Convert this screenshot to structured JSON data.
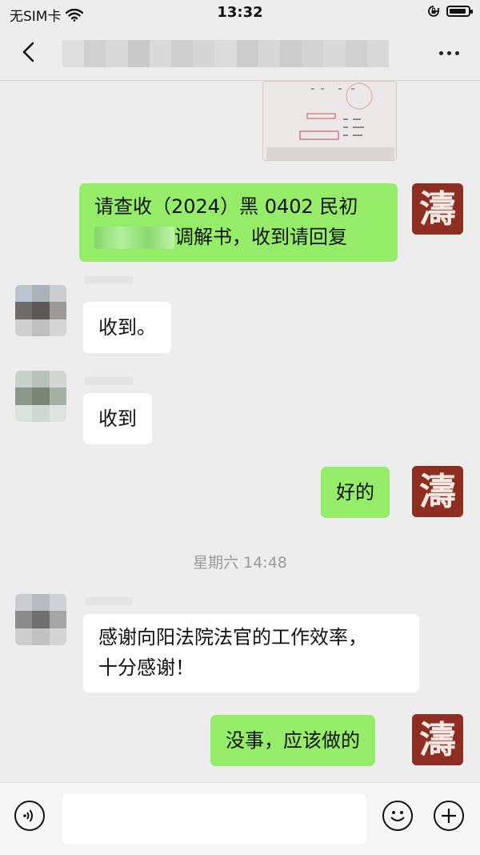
{
  "status_bar": {
    "carrier": "无SIM卡",
    "time": "13:32",
    "battery_level": 0.9
  },
  "nav": {
    "back_icon": "chevron-left-icon",
    "more_icon": "more-dots-icon"
  },
  "messages": [
    {
      "side": "right",
      "type": "image"
    },
    {
      "side": "right",
      "type": "text",
      "line1": "请查收（2024）黑 0402 民初",
      "line2_suffix": "调解书，收到请回复"
    },
    {
      "side": "left",
      "type": "text",
      "text": "收到。"
    },
    {
      "side": "left",
      "type": "text",
      "text": "收到"
    },
    {
      "side": "right",
      "type": "text",
      "text": "好的"
    },
    {
      "type": "time",
      "text": "星期六 14:48"
    },
    {
      "side": "left",
      "type": "text",
      "line1": "感谢向阳法院法官的工作效率，",
      "line2": "十分感谢！"
    },
    {
      "side": "right",
      "type": "text",
      "text": "没事，应该做的"
    }
  ],
  "my_avatar_glyph": "濤",
  "composer": {
    "voice_icon": "voice-icon",
    "emoji_icon": "emoji-icon",
    "plus_icon": "plus-icon"
  },
  "colors": {
    "background": "#ededed",
    "my_bubble": "#95ec69",
    "their_bubble": "#ffffff",
    "avatar_red": "#8e2d22"
  }
}
